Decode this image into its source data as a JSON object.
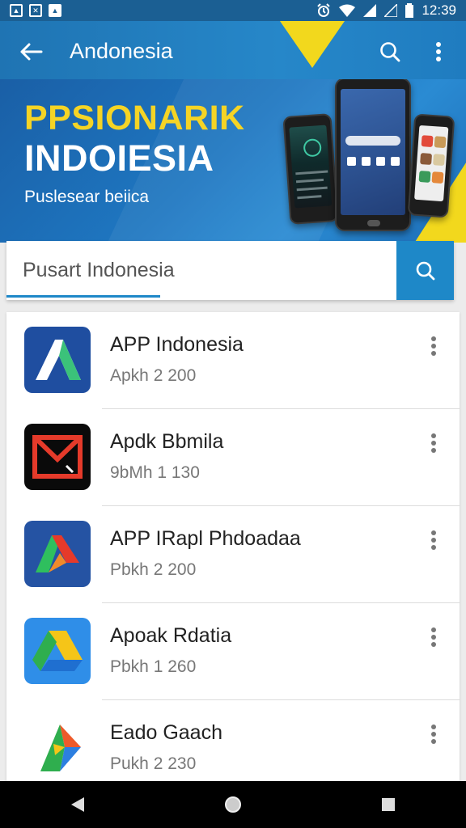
{
  "status_bar": {
    "time": "12:39",
    "icons": [
      "image-icon",
      "gallery-icon",
      "photo-icon",
      "alarm-icon",
      "wifi-icon",
      "signal-icon",
      "signal-icon",
      "battery-icon"
    ]
  },
  "app_bar": {
    "title": "Andonesia",
    "back_icon": "arrow-left-icon",
    "search_icon": "search-icon",
    "more_icon": "more-vertical-icon"
  },
  "banner": {
    "title_line1": "PPSIONARIK",
    "title_line2": "INDOIESIA",
    "subtitle": "Puslesear beiica"
  },
  "search": {
    "value": "Pusart Indonesia",
    "placeholder": "",
    "submit_icon": "search-icon"
  },
  "apps": [
    {
      "title": "APP Indonesia",
      "subtitle": "Apkh 2 200",
      "icon": "triangle-a-icon",
      "colors": [
        "#1f4ea0",
        "#ffffff",
        "#3bc27a"
      ]
    },
    {
      "title": "Apdk Bbmila",
      "subtitle": "9bMh 1 130",
      "icon": "mail-icon",
      "colors": [
        "#0a0a0a",
        "#e53a2a"
      ]
    },
    {
      "title": "APP IRapl Phdoadaa",
      "subtitle": "Pbkh 2 200",
      "icon": "triangle-multicolor-icon",
      "colors": [
        "#2553a3",
        "#e53a2a",
        "#2fbf5e"
      ]
    },
    {
      "title": "Apoak Rdatia",
      "subtitle": "Pbkh 1 260",
      "icon": "drive-icon",
      "colors": [
        "#2f8ee8",
        "#f5c518",
        "#2fae4e"
      ]
    },
    {
      "title": "Eado Gaach",
      "subtitle": "Pukh 2 230",
      "icon": "play-multicolor-icon",
      "colors": [
        "#ffffff",
        "#ee5a2a",
        "#2c7fe0",
        "#2fae4e"
      ]
    }
  ],
  "nav": {
    "back_icon": "nav-back-icon",
    "home_icon": "nav-home-icon",
    "recents_icon": "nav-recents-icon"
  }
}
